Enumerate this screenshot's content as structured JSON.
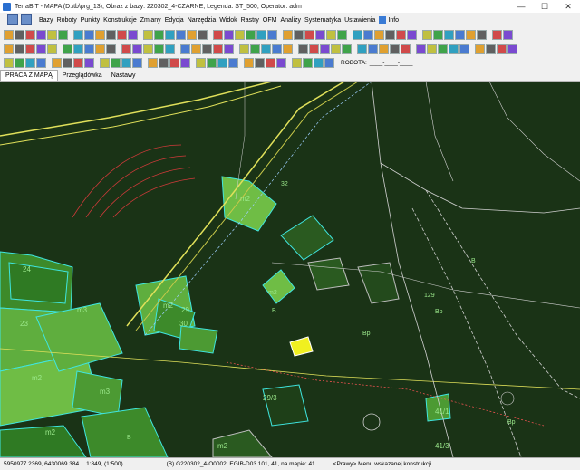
{
  "window": {
    "title": "TerraBIT - MAPA (D:\\tb\\prg_13),  Obraz z bazy: 220302_4-CZARNE,  Legenda: ST_500,  Operator: adm",
    "minimize": "—",
    "maximize": "☐",
    "close": "✕"
  },
  "menu": [
    "Bazy",
    "Roboty",
    "Punkty",
    "Konstrukcje",
    "Zmiany",
    "Edycja",
    "Narzędzia",
    "Widok",
    "Rastry",
    "OFM",
    "Analizy",
    "Systematyka",
    "Ustawienia",
    "Info"
  ],
  "toolbar": {
    "robota_label": "ROBOTA:",
    "robota_value": "____-____-____"
  },
  "tabs": [
    "PRACA Z MAPĄ",
    "Przeglądówka",
    "Nastawy"
  ],
  "map": {
    "labels": [
      "24",
      "23",
      "m2",
      "m3",
      "m2",
      "m3",
      "29",
      "30",
      "m2",
      "m2",
      "41/3",
      "41/1",
      "129",
      "m2",
      "32",
      "Bp",
      "Bp",
      "Bp",
      "B",
      "29/3",
      "m2",
      "B",
      "B"
    ]
  },
  "status": {
    "coords": "5950977.2369,  6430069.384",
    "scale": "1:849, (1:500)",
    "object": "(B) G220302_4-O0002,  EGIB-D03.101, 41,  na mapie: 41",
    "hint": "<Prawy> Menu wskazanej konstrukcji"
  },
  "colors": {
    "map_background": "#1a3316",
    "parcel_fill": "#5fae3e",
    "parcel_outline": "#3fe6e0",
    "road": "#e0e05a",
    "selected": "#f0f020"
  }
}
